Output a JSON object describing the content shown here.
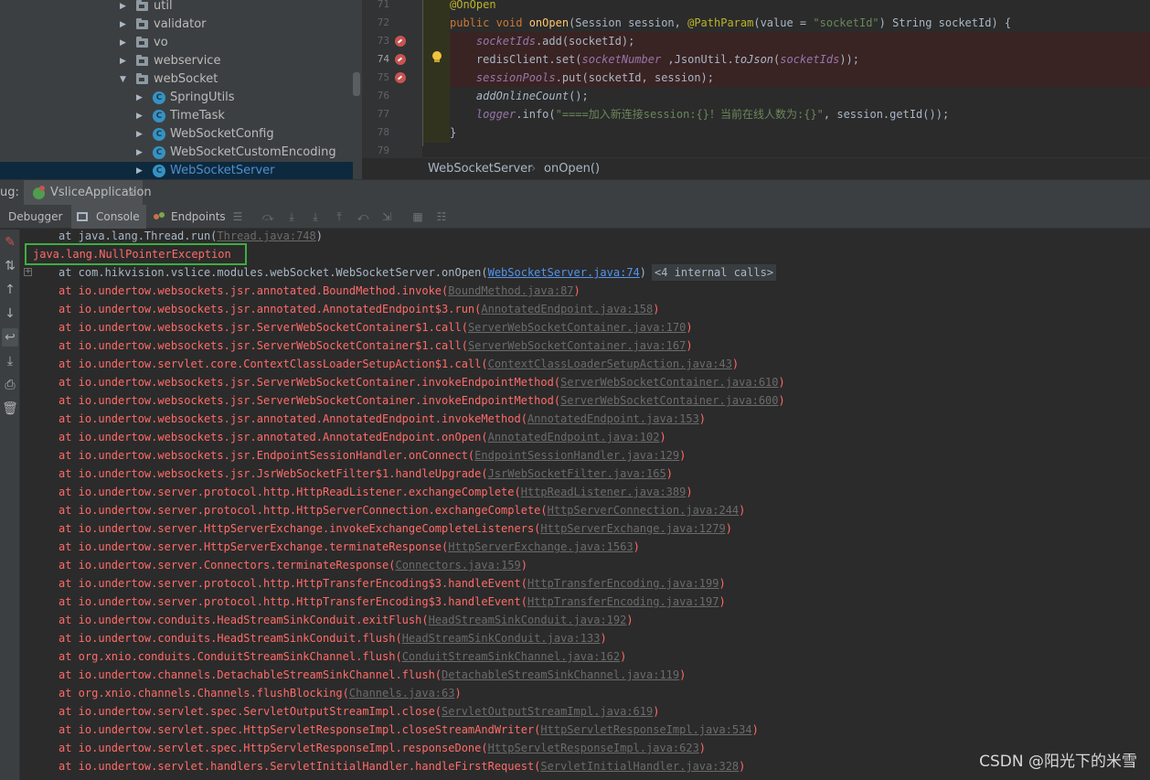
{
  "project_tree": {
    "items": [
      {
        "label": "util",
        "kind": "folder",
        "expanded": false
      },
      {
        "label": "validator",
        "kind": "folder",
        "expanded": false
      },
      {
        "label": "vo",
        "kind": "folder",
        "expanded": false
      },
      {
        "label": "webservice",
        "kind": "folder",
        "expanded": false
      },
      {
        "label": "webSocket",
        "kind": "folder",
        "expanded": true
      },
      {
        "label": "SpringUtils",
        "kind": "class",
        "expanded": false
      },
      {
        "label": "TimeTask",
        "kind": "class",
        "expanded": false
      },
      {
        "label": "WebSocketConfig",
        "kind": "class",
        "expanded": false
      },
      {
        "label": "WebSocketCustomEncoding",
        "kind": "class",
        "expanded": false
      },
      {
        "label": "WebSocketServer",
        "kind": "class",
        "expanded": false,
        "selected": true
      }
    ]
  },
  "editor": {
    "line_numbers": [
      "71",
      "72",
      "73",
      "74",
      "75",
      "76",
      "77",
      "78",
      "79"
    ],
    "breakpoint_lines": [
      "73",
      "74",
      "75"
    ],
    "current_line": "74",
    "code": {
      "l71_ann": "@OnOpen",
      "l72_kw": "public void ",
      "l72_fn": "onOpen",
      "l72_a": "(Session session, ",
      "l72_ann": "@PathParam",
      "l72_b": "(value = ",
      "l72_str": "\"socketId\"",
      "l72_c": ") String socketId) {",
      "l73_fld": "socketIds",
      "l73_rest": ".add(socketId);",
      "l74_a": "redisClient.set(",
      "l74_fld": "socketNumber",
      "l74_b": " ,JsonUtil.",
      "l74_it": "toJson",
      "l74_c": "(",
      "l74_fld2": "socketIds",
      "l74_d": "));",
      "l75_fld": "sessionPools",
      "l75_rest": ".put(socketId, session);",
      "l76_it": "addOnlineCount",
      "l76_rest": "();",
      "l77_fld": "logger",
      "l77_a": ".info(",
      "l77_str": "\"====加入新连接session:{}！当前在线人数为:{}\"",
      "l77_b": ", session.getId());",
      "l78": "}"
    }
  },
  "breadcrumb": {
    "class": "WebSocketServer",
    "separator": "›",
    "method": "onOpen()"
  },
  "debug": {
    "prefix": "ug:",
    "config": "VsliceApplication",
    "close": "×",
    "tabs": [
      "Debugger",
      "Console",
      "Endpoints"
    ],
    "active_tab": "Console"
  },
  "console": {
    "first_line": {
      "text": "at java.lang.Thread.run(",
      "link": "Thread.java:748",
      "tail": ")"
    },
    "exception": "java.lang.NullPointerException",
    "expand": "+",
    "internal_calls": "<4 internal calls>",
    "frames": [
      {
        "text": "at com.hikvision.vslice.modules.webSocket.WebSocketServer.onOpen(",
        "link": "WebSocketServer.java:74",
        "tail": ")"
      },
      {
        "text": "at io.undertow.websockets.jsr.annotated.BoundMethod.invoke(",
        "link": "BoundMethod.java:87",
        "tail": ")"
      },
      {
        "text": "at io.undertow.websockets.jsr.annotated.AnnotatedEndpoint$3.run(",
        "link": "AnnotatedEndpoint.java:158",
        "tail": ")"
      },
      {
        "text": "at io.undertow.websockets.jsr.ServerWebSocketContainer$1.call(",
        "link": "ServerWebSocketContainer.java:170",
        "tail": ")"
      },
      {
        "text": "at io.undertow.websockets.jsr.ServerWebSocketContainer$1.call(",
        "link": "ServerWebSocketContainer.java:167",
        "tail": ")"
      },
      {
        "text": "at io.undertow.servlet.core.ContextClassLoaderSetupAction$1.call(",
        "link": "ContextClassLoaderSetupAction.java:43",
        "tail": ")"
      },
      {
        "text": "at io.undertow.websockets.jsr.ServerWebSocketContainer.invokeEndpointMethod(",
        "link": "ServerWebSocketContainer.java:610",
        "tail": ")"
      },
      {
        "text": "at io.undertow.websockets.jsr.ServerWebSocketContainer.invokeEndpointMethod(",
        "link": "ServerWebSocketContainer.java:600",
        "tail": ")"
      },
      {
        "text": "at io.undertow.websockets.jsr.annotated.AnnotatedEndpoint.invokeMethod(",
        "link": "AnnotatedEndpoint.java:153",
        "tail": ")"
      },
      {
        "text": "at io.undertow.websockets.jsr.annotated.AnnotatedEndpoint.onOpen(",
        "link": "AnnotatedEndpoint.java:102",
        "tail": ")"
      },
      {
        "text": "at io.undertow.websockets.jsr.EndpointSessionHandler.onConnect(",
        "link": "EndpointSessionHandler.java:129",
        "tail": ")"
      },
      {
        "text": "at io.undertow.websockets.jsr.JsrWebSocketFilter$1.handleUpgrade(",
        "link": "JsrWebSocketFilter.java:165",
        "tail": ")"
      },
      {
        "text": "at io.undertow.server.protocol.http.HttpReadListener.exchangeComplete(",
        "link": "HttpReadListener.java:389",
        "tail": ")"
      },
      {
        "text": "at io.undertow.server.protocol.http.HttpServerConnection.exchangeComplete(",
        "link": "HttpServerConnection.java:244",
        "tail": ")"
      },
      {
        "text": "at io.undertow.server.HttpServerExchange.invokeExchangeCompleteListeners(",
        "link": "HttpServerExchange.java:1279",
        "tail": ")"
      },
      {
        "text": "at io.undertow.server.HttpServerExchange.terminateResponse(",
        "link": "HttpServerExchange.java:1563",
        "tail": ")"
      },
      {
        "text": "at io.undertow.server.Connectors.terminateResponse(",
        "link": "Connectors.java:159",
        "tail": ")"
      },
      {
        "text": "at io.undertow.server.protocol.http.HttpTransferEncoding$3.handleEvent(",
        "link": "HttpTransferEncoding.java:199",
        "tail": ")"
      },
      {
        "text": "at io.undertow.server.protocol.http.HttpTransferEncoding$3.handleEvent(",
        "link": "HttpTransferEncoding.java:197",
        "tail": ")"
      },
      {
        "text": "at io.undertow.conduits.HeadStreamSinkConduit.exitFlush(",
        "link": "HeadStreamSinkConduit.java:192",
        "tail": ")"
      },
      {
        "text": "at io.undertow.conduits.HeadStreamSinkConduit.flush(",
        "link": "HeadStreamSinkConduit.java:133",
        "tail": ")"
      },
      {
        "text": "at org.xnio.conduits.ConduitStreamSinkChannel.flush(",
        "link": "ConduitStreamSinkChannel.java:162",
        "tail": ")"
      },
      {
        "text": "at io.undertow.channels.DetachableStreamSinkChannel.flush(",
        "link": "DetachableStreamSinkChannel.java:119",
        "tail": ")"
      },
      {
        "text": "at org.xnio.channels.Channels.flushBlocking(",
        "link": "Channels.java:63",
        "tail": ")"
      },
      {
        "text": "at io.undertow.servlet.spec.ServletOutputStreamImpl.close(",
        "link": "ServletOutputStreamImpl.java:619",
        "tail": ")"
      },
      {
        "text": "at io.undertow.servlet.spec.HttpServletResponseImpl.closeStreamAndWriter(",
        "link": "HttpServletResponseImpl.java:534",
        "tail": ")"
      },
      {
        "text": "at io.undertow.servlet.spec.HttpServletResponseImpl.responseDone(",
        "link": "HttpServletResponseImpl.java:623",
        "tail": ")"
      },
      {
        "text": "at io.undertow.servlet.handlers.ServletInitialHandler.handleFirstRequest(",
        "link": "ServletInitialHandler.java:328",
        "tail": ")"
      }
    ]
  },
  "watermark": "CSDN @阳光下的米雪",
  "colors": {
    "error_text": "#ff6b68",
    "highlight_box": "#3dae3f",
    "selection": "#0d293e"
  }
}
